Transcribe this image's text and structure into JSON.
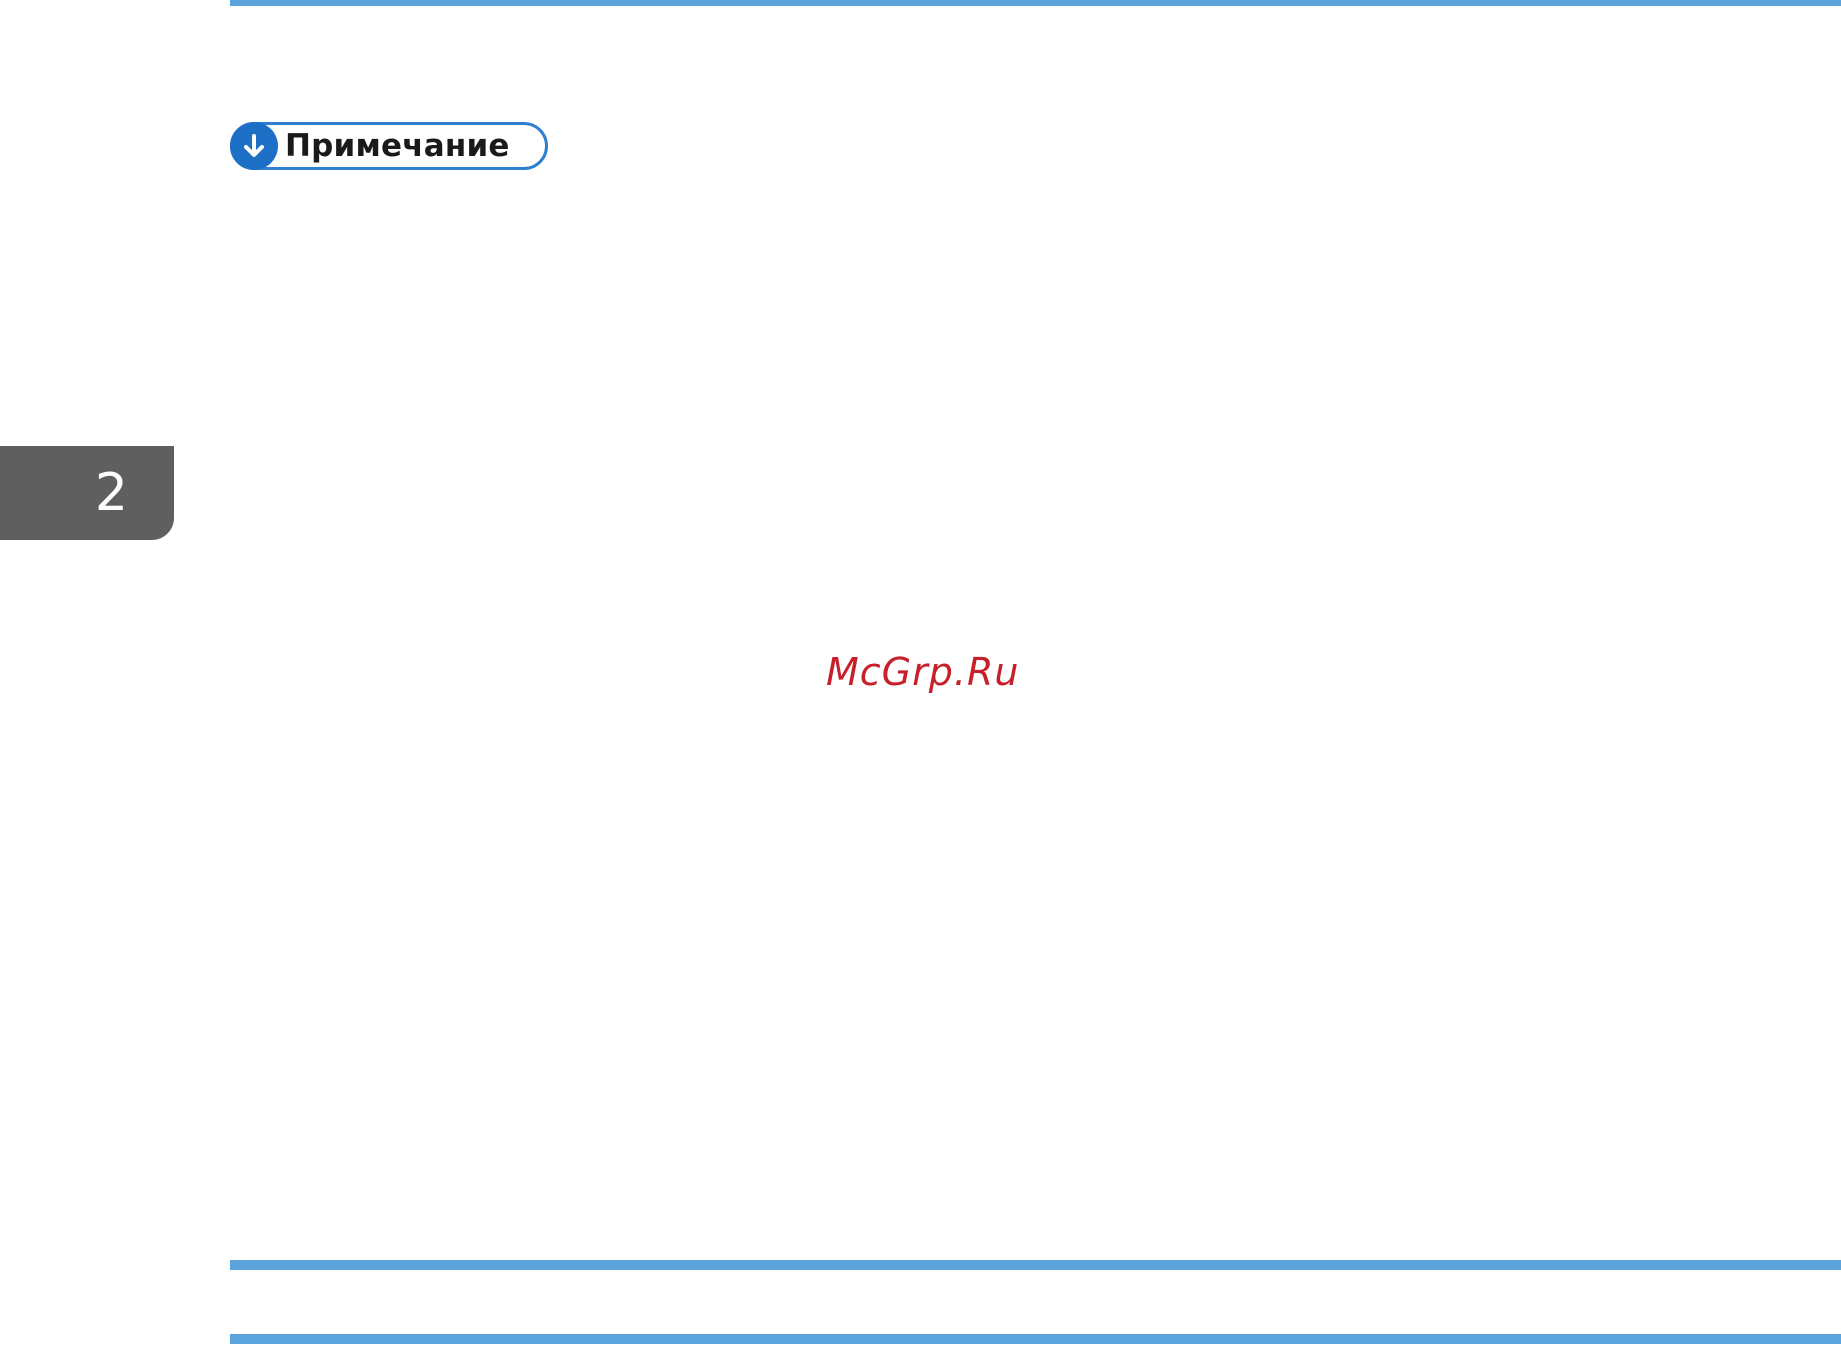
{
  "note": {
    "label": "Примечание",
    "icon": "down-arrow-icon",
    "accent_color": "#1e6fc6"
  },
  "chapter_tab": {
    "number": "2",
    "color": "#5f5f5f"
  },
  "watermark": {
    "text": "McGrp.Ru",
    "color": "#c8202a"
  },
  "rule_color": "#5aa3dc"
}
